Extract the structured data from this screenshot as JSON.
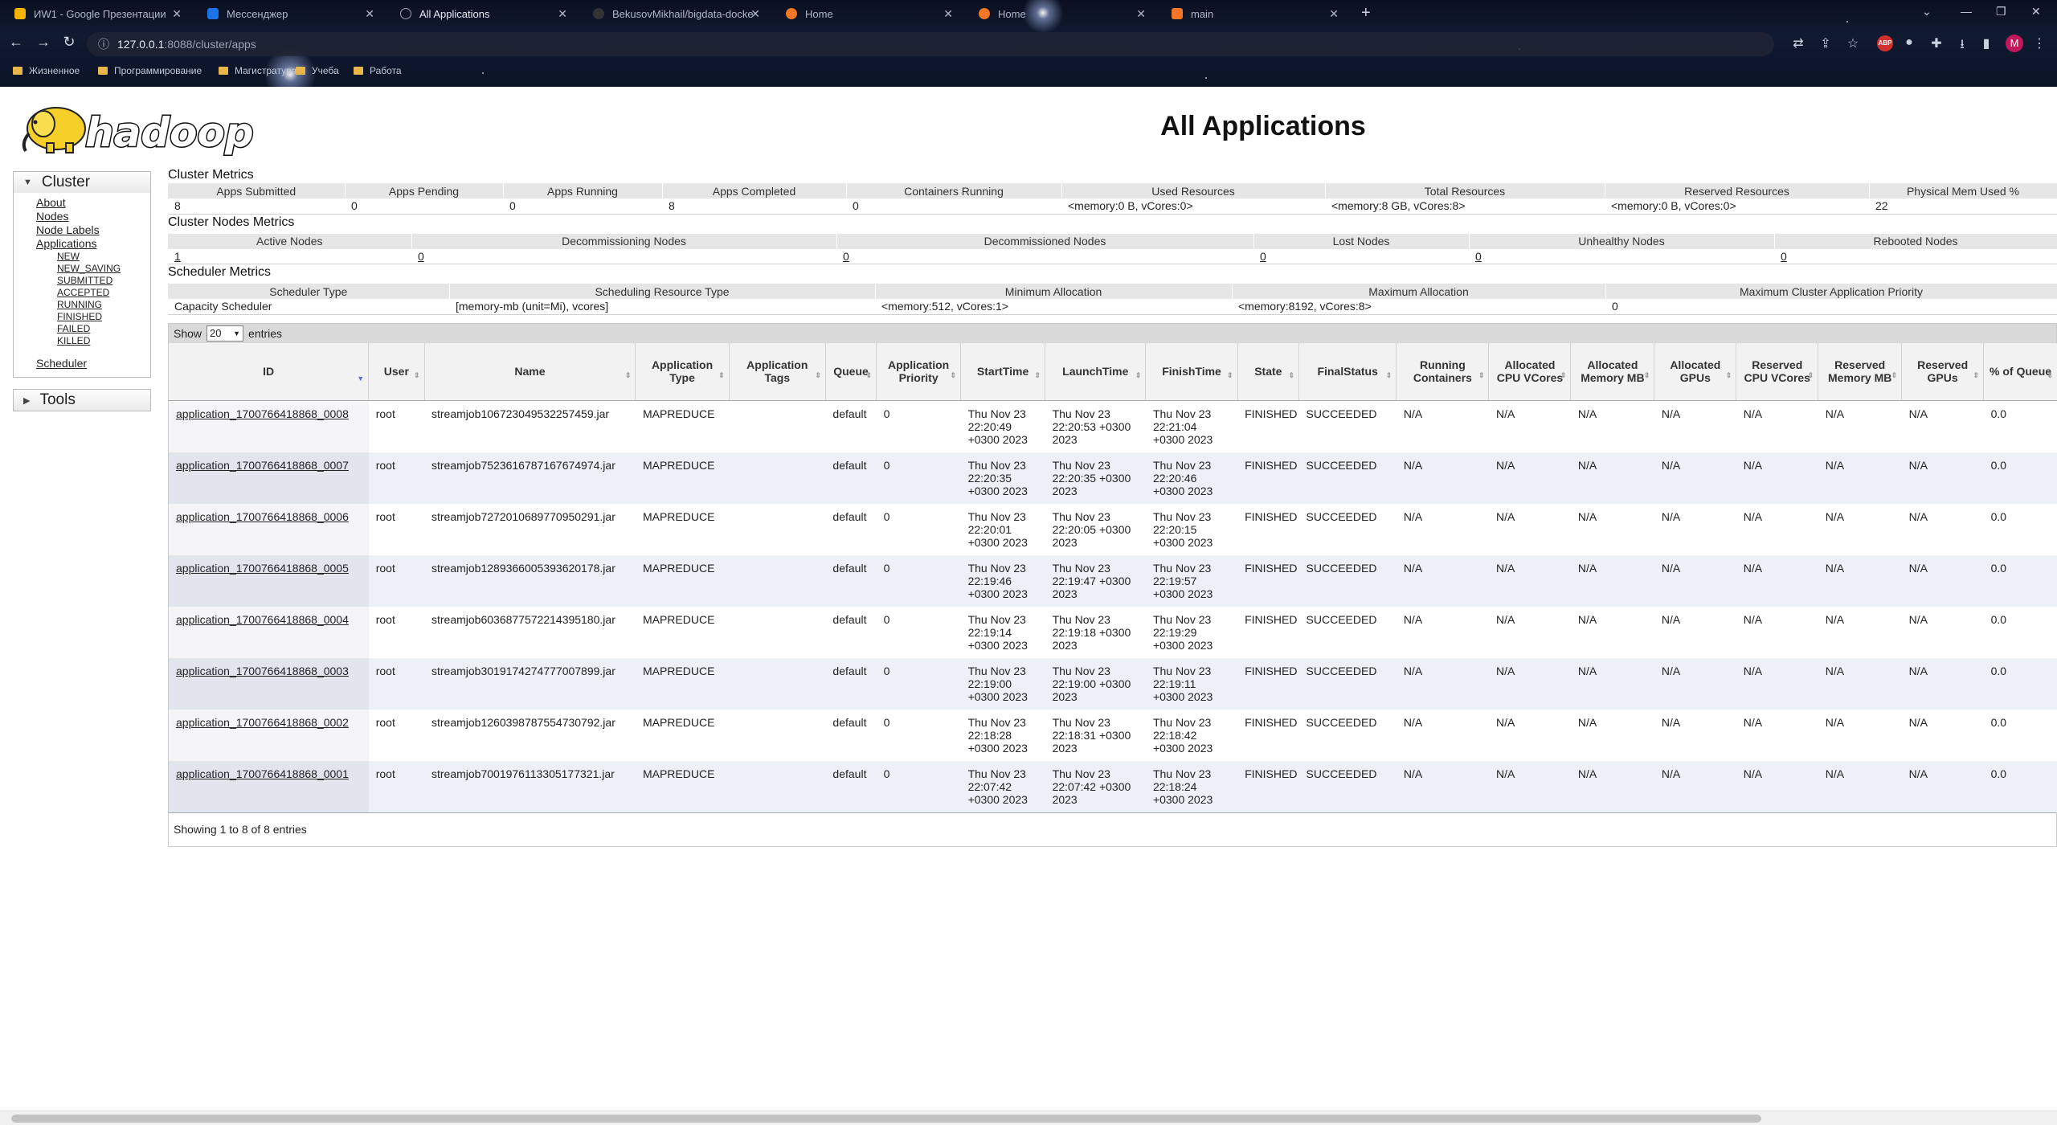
{
  "browser": {
    "tabs": [
      {
        "title": "ИW1 - Google Презентации",
        "favicon_color": "#f4b400",
        "active": false
      },
      {
        "title": "Мессенджер",
        "favicon_color": "#1a73e8",
        "active": false
      },
      {
        "title": "All Applications",
        "favicon_color": "#9aa3b4",
        "active": true
      },
      {
        "title": "BekusovMikhail/bigdata-docke",
        "favicon_color": "#333333",
        "active": false
      },
      {
        "title": "Home",
        "favicon_color": "#f37626",
        "active": false
      },
      {
        "title": "Home",
        "favicon_color": "#f37626",
        "active": false
      },
      {
        "title": "main",
        "favicon_color": "#f37626",
        "active": false
      }
    ],
    "url_host": "127.0.0.1",
    "url_rest": ":8088/cluster/apps",
    "bookmarks": [
      "Жизненное",
      "Программирование",
      "Магистратура",
      "Учеба",
      "Работа"
    ],
    "avatar_letter": "M",
    "abp_label": "ABP"
  },
  "page_title": "All Applications",
  "logo_text": "hadoop",
  "sidebar": {
    "cluster_label": "Cluster",
    "cluster_links": [
      "About",
      "Nodes",
      "Node Labels",
      "Applications"
    ],
    "app_states": [
      "NEW",
      "NEW_SAVING",
      "SUBMITTED",
      "ACCEPTED",
      "RUNNING",
      "FINISHED",
      "FAILED",
      "KILLED"
    ],
    "scheduler_link": "Scheduler",
    "tools_label": "Tools"
  },
  "cluster_metrics": {
    "title": "Cluster Metrics",
    "headers": [
      "Apps Submitted",
      "Apps Pending",
      "Apps Running",
      "Apps Completed",
      "Containers Running",
      "Used Resources",
      "Total Resources",
      "Reserved Resources",
      "Physical Mem Used %"
    ],
    "values": [
      "8",
      "0",
      "0",
      "8",
      "0",
      "<memory:0 B, vCores:0>",
      "<memory:8 GB, vCores:8>",
      "<memory:0 B, vCores:0>",
      "22"
    ]
  },
  "node_metrics": {
    "title": "Cluster Nodes Metrics",
    "headers": [
      "Active Nodes",
      "Decommissioning Nodes",
      "Decommissioned Nodes",
      "Lost Nodes",
      "Unhealthy Nodes",
      "Rebooted Nodes"
    ],
    "values": [
      "1",
      "0",
      "0",
      "0",
      "0",
      "0"
    ]
  },
  "scheduler_metrics": {
    "title": "Scheduler Metrics",
    "headers": [
      "Scheduler Type",
      "Scheduling Resource Type",
      "Minimum Allocation",
      "Maximum Allocation",
      "Maximum Cluster Application Priority"
    ],
    "values": [
      "Capacity Scheduler",
      "[memory-mb (unit=Mi), vcores]",
      "<memory:512, vCores:1>",
      "<memory:8192, vCores:8>",
      "0"
    ]
  },
  "apps_table": {
    "show_label": "Show",
    "entries_label": "entries",
    "page_length": "20",
    "columns": [
      "ID",
      "User",
      "Name",
      "Application Type",
      "Application Tags",
      "Queue",
      "Application Priority",
      "StartTime",
      "LaunchTime",
      "FinishTime",
      "State",
      "FinalStatus",
      "Running Containers",
      "Allocated CPU VCores",
      "Allocated Memory MB",
      "Allocated GPUs",
      "Reserved CPU VCores",
      "Reserved Memory MB",
      "Reserved GPUs",
      "% of Queue"
    ],
    "rows": [
      [
        "application_1700766418868_0008",
        "root",
        "streamjob106723049532257459.jar",
        "MAPREDUCE",
        "",
        "default",
        "0",
        "Thu Nov 23 22:20:49 +0300 2023",
        "Thu Nov 23 22:20:53 +0300 2023",
        "Thu Nov 23 22:21:04 +0300 2023",
        "FINISHED",
        "SUCCEEDED",
        "N/A",
        "N/A",
        "N/A",
        "N/A",
        "N/A",
        "N/A",
        "N/A",
        "0.0"
      ],
      [
        "application_1700766418868_0007",
        "root",
        "streamjob7523616787167674974.jar",
        "MAPREDUCE",
        "",
        "default",
        "0",
        "Thu Nov 23 22:20:35 +0300 2023",
        "Thu Nov 23 22:20:35 +0300 2023",
        "Thu Nov 23 22:20:46 +0300 2023",
        "FINISHED",
        "SUCCEEDED",
        "N/A",
        "N/A",
        "N/A",
        "N/A",
        "N/A",
        "N/A",
        "N/A",
        "0.0"
      ],
      [
        "application_1700766418868_0006",
        "root",
        "streamjob7272010689770950291.jar",
        "MAPREDUCE",
        "",
        "default",
        "0",
        "Thu Nov 23 22:20:01 +0300 2023",
        "Thu Nov 23 22:20:05 +0300 2023",
        "Thu Nov 23 22:20:15 +0300 2023",
        "FINISHED",
        "SUCCEEDED",
        "N/A",
        "N/A",
        "N/A",
        "N/A",
        "N/A",
        "N/A",
        "N/A",
        "0.0"
      ],
      [
        "application_1700766418868_0005",
        "root",
        "streamjob1289366005393620178.jar",
        "MAPREDUCE",
        "",
        "default",
        "0",
        "Thu Nov 23 22:19:46 +0300 2023",
        "Thu Nov 23 22:19:47 +0300 2023",
        "Thu Nov 23 22:19:57 +0300 2023",
        "FINISHED",
        "SUCCEEDED",
        "N/A",
        "N/A",
        "N/A",
        "N/A",
        "N/A",
        "N/A",
        "N/A",
        "0.0"
      ],
      [
        "application_1700766418868_0004",
        "root",
        "streamjob6036877572214395180.jar",
        "MAPREDUCE",
        "",
        "default",
        "0",
        "Thu Nov 23 22:19:14 +0300 2023",
        "Thu Nov 23 22:19:18 +0300 2023",
        "Thu Nov 23 22:19:29 +0300 2023",
        "FINISHED",
        "SUCCEEDED",
        "N/A",
        "N/A",
        "N/A",
        "N/A",
        "N/A",
        "N/A",
        "N/A",
        "0.0"
      ],
      [
        "application_1700766418868_0003",
        "root",
        "streamjob3019174274777007899.jar",
        "MAPREDUCE",
        "",
        "default",
        "0",
        "Thu Nov 23 22:19:00 +0300 2023",
        "Thu Nov 23 22:19:00 +0300 2023",
        "Thu Nov 23 22:19:11 +0300 2023",
        "FINISHED",
        "SUCCEEDED",
        "N/A",
        "N/A",
        "N/A",
        "N/A",
        "N/A",
        "N/A",
        "N/A",
        "0.0"
      ],
      [
        "application_1700766418868_0002",
        "root",
        "streamjob1260398787554730792.jar",
        "MAPREDUCE",
        "",
        "default",
        "0",
        "Thu Nov 23 22:18:28 +0300 2023",
        "Thu Nov 23 22:18:31 +0300 2023",
        "Thu Nov 23 22:18:42 +0300 2023",
        "FINISHED",
        "SUCCEEDED",
        "N/A",
        "N/A",
        "N/A",
        "N/A",
        "N/A",
        "N/A",
        "N/A",
        "0.0"
      ],
      [
        "application_1700766418868_0001",
        "root",
        "streamjob7001976113305177321.jar",
        "MAPREDUCE",
        "",
        "default",
        "0",
        "Thu Nov 23 22:07:42 +0300 2023",
        "Thu Nov 23 22:07:42 +0300 2023",
        "Thu Nov 23 22:18:24 +0300 2023",
        "FINISHED",
        "SUCCEEDED",
        "N/A",
        "N/A",
        "N/A",
        "N/A",
        "N/A",
        "N/A",
        "N/A",
        "0.0"
      ]
    ],
    "info": "Showing 1 to 8 of 8 entries"
  }
}
